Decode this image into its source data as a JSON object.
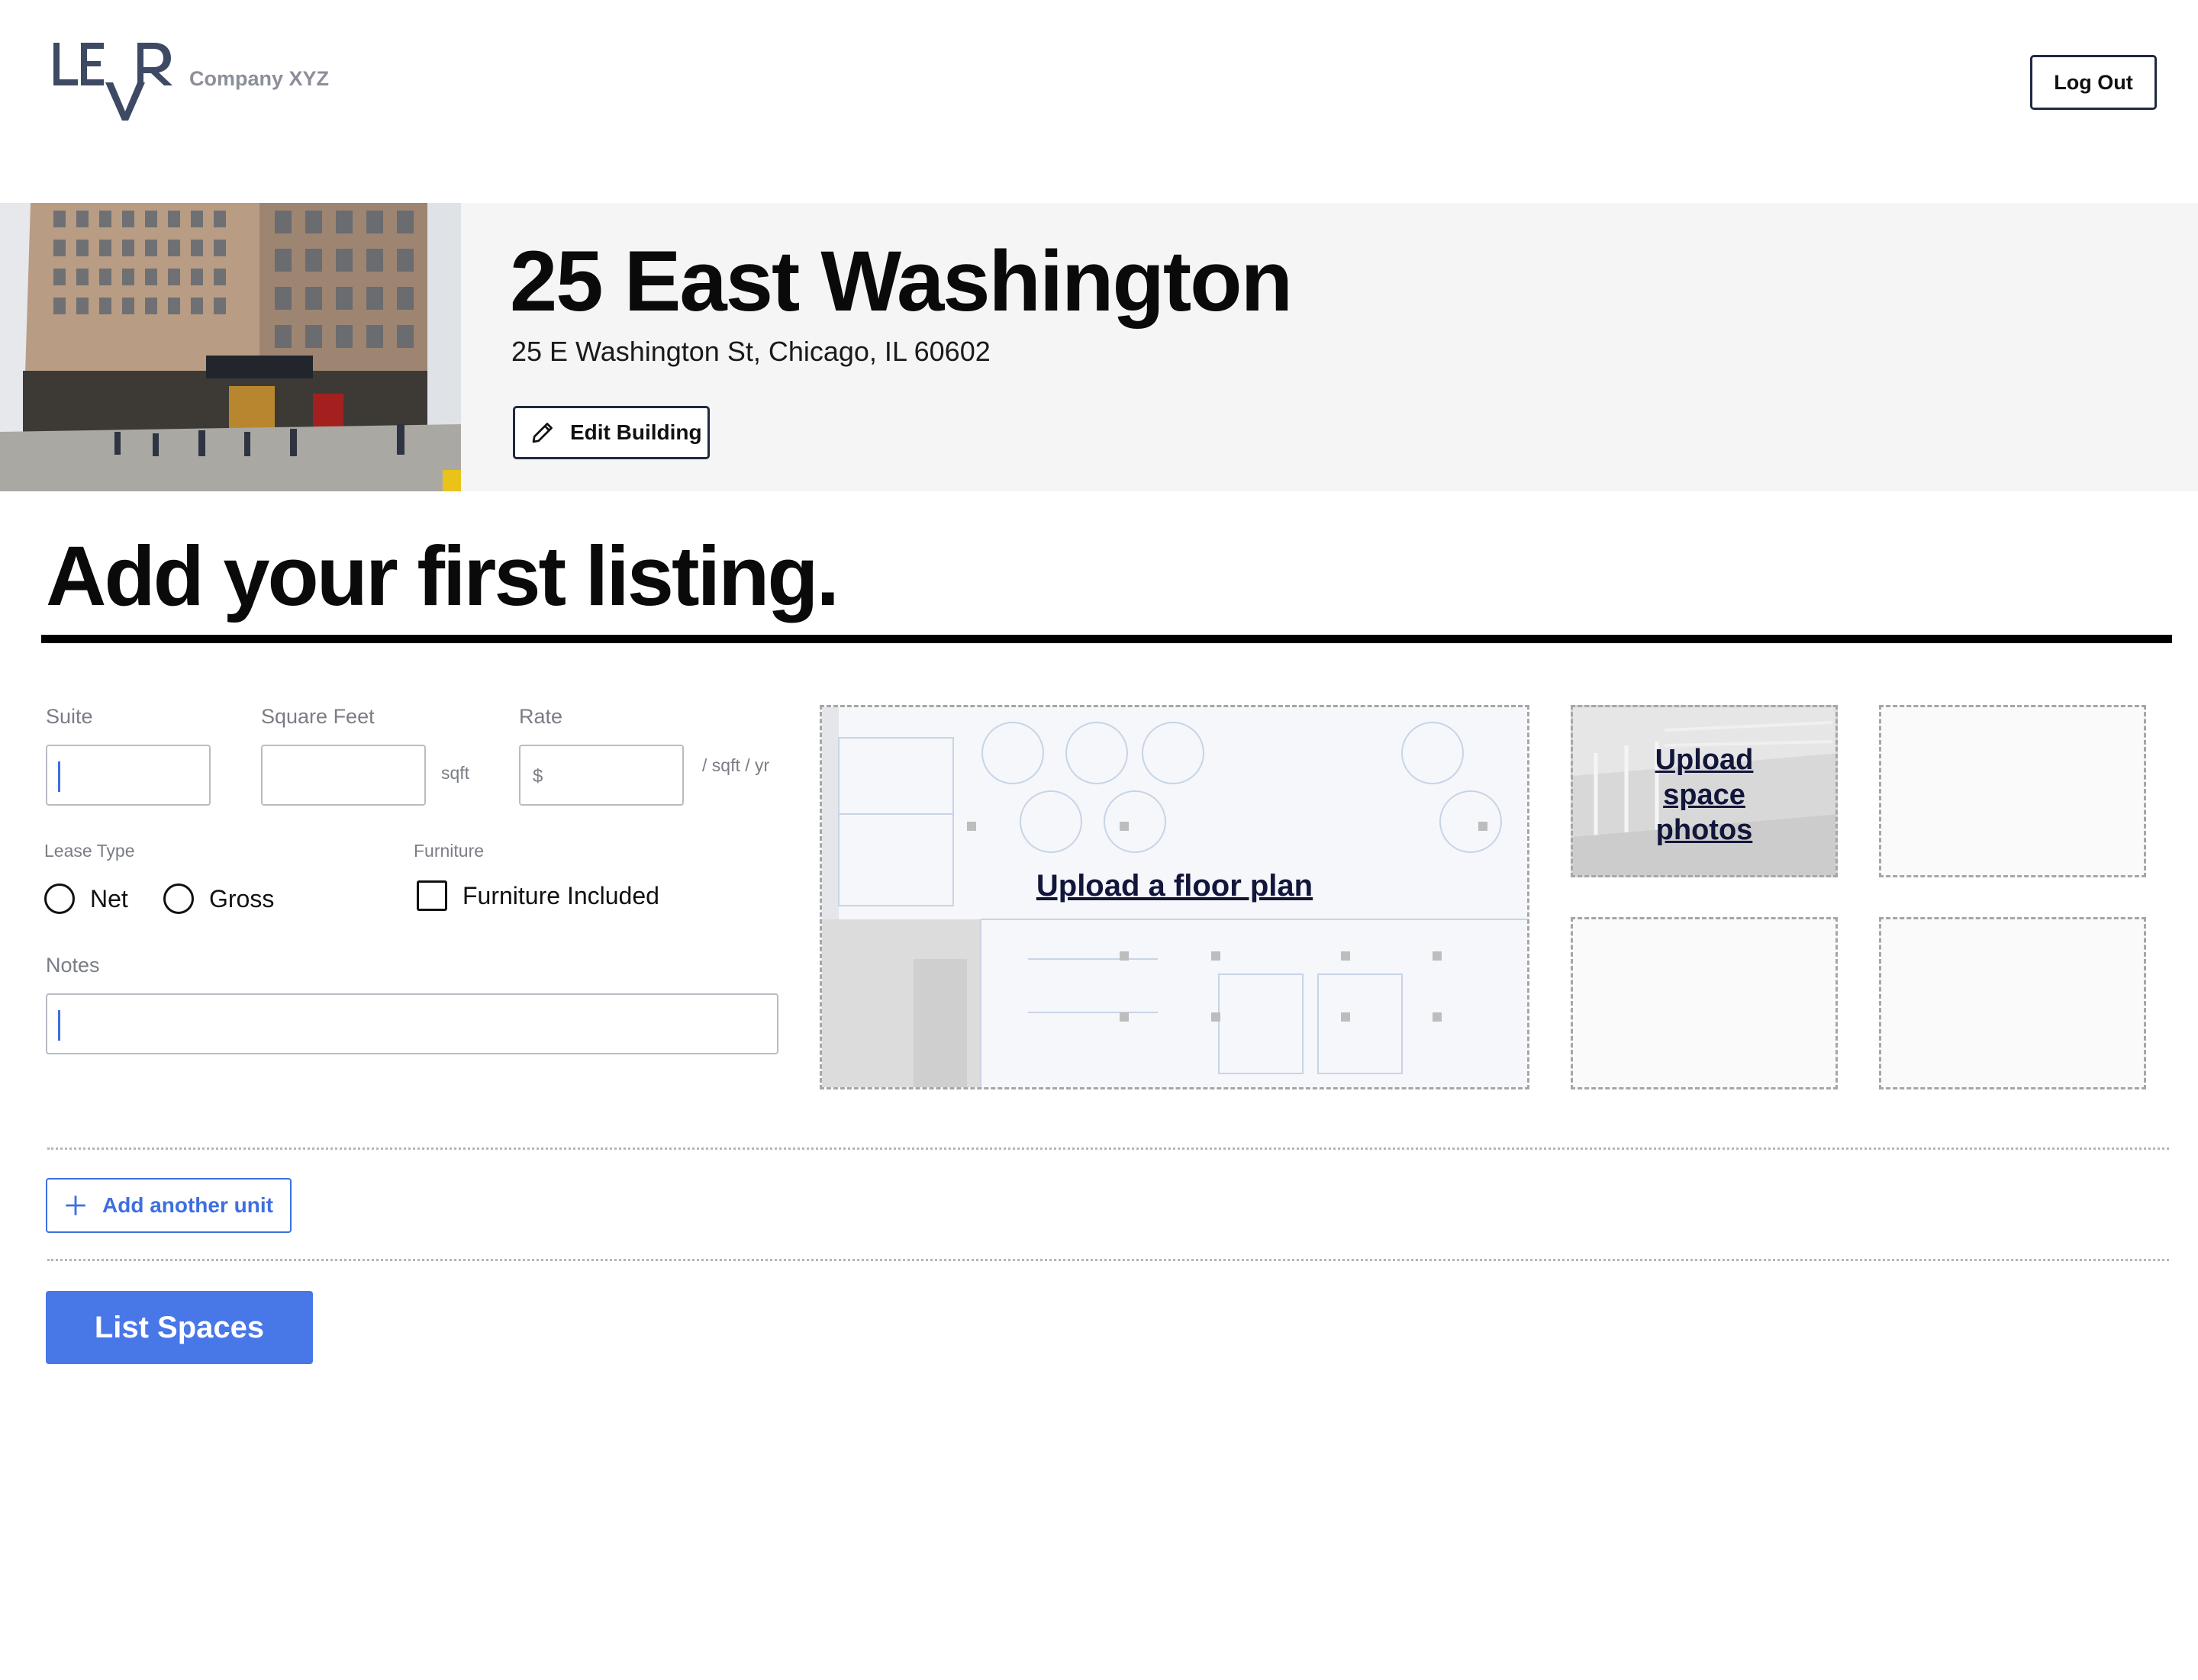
{
  "header": {
    "logo_text": "LEVR",
    "company": "Company XYZ",
    "logout_label": "Log Out"
  },
  "building": {
    "name": "25 East Washington",
    "address": "25 E Washington St, Chicago, IL 60602",
    "edit_label": "Edit Building",
    "photo_icon": "building-photo"
  },
  "page": {
    "title": "Add your first listing."
  },
  "form": {
    "suite_label": "Suite",
    "suite_value": "",
    "sqft_label": "Square Feet",
    "sqft_value": "",
    "sqft_unit": "sqft",
    "rate_label": "Rate",
    "rate_prefix": "$",
    "rate_value": "",
    "rate_unit": "/ sqft / yr",
    "lease_type_label": "Lease Type",
    "lease_options": [
      "Net",
      "Gross"
    ],
    "lease_selected": null,
    "furniture_label": "Furniture",
    "furniture_option": "Furniture Included",
    "furniture_checked": false,
    "notes_label": "Notes",
    "notes_value": ""
  },
  "uploads": {
    "floor_plan": "Upload a floor plan",
    "photos_line1": "Upload",
    "photos_line2": "space",
    "photos_line3": "photos"
  },
  "actions": {
    "add_unit": "Add another unit",
    "list_spaces": "List Spaces"
  },
  "colors": {
    "accent": "#4877e8",
    "navy": "#1f2942",
    "banner_bg": "#f5f5f5",
    "muted_text": "#7a7d85"
  }
}
